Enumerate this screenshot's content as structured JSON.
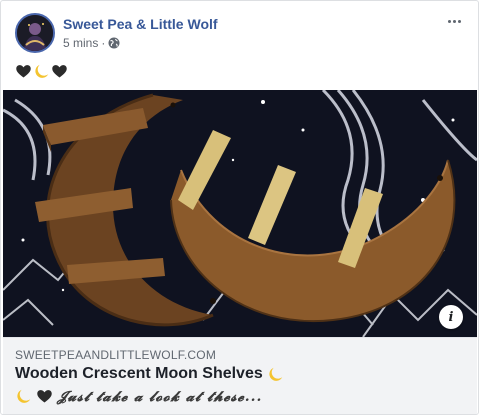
{
  "post": {
    "author": "Sweet Pea & Little Wolf",
    "timestamp": "5 mins",
    "separator": "·",
    "privacy_icon": "globe-icon",
    "more_icon": "more-dots-icon",
    "text_emojis": [
      "black-heart-icon",
      "crescent-moon-icon",
      "black-heart-icon"
    ]
  },
  "media": {
    "description_icon": "info-icon",
    "info_label": "i"
  },
  "link_preview": {
    "domain": "SWEETPEAANDLITTLEWOLF.COM",
    "title": "Wooden Crescent Moon Shelves",
    "title_emoji": "crescent-moon-icon",
    "description_emojis": [
      "crescent-moon-icon",
      "black-heart-icon"
    ],
    "description": "𝓙𝓾𝓼𝓽 𝓽𝓪𝓴𝓮 𝓪 𝓵𝓸𝓸𝓴 𝓪𝓽 𝓽𝓱𝓮𝓼𝓮..."
  },
  "colors": {
    "author_link": "#385898",
    "meta_text": "#616770",
    "link_box_bg": "#f2f3f5",
    "shelf_wood": "#8b5a2b",
    "shelf_edge": "#d8c07a",
    "fabric_bg": "#0f1220"
  }
}
